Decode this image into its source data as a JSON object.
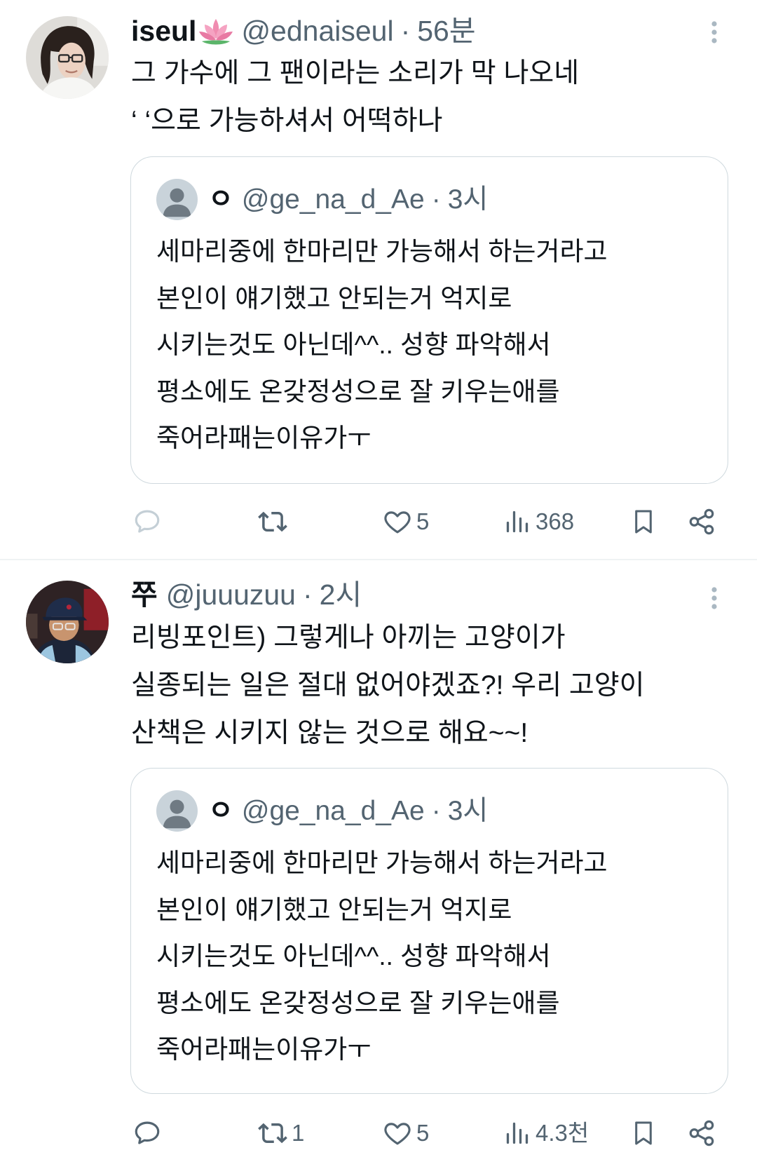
{
  "separator": "·",
  "colors": {
    "primary_text": "#0f1419",
    "secondary_text": "#536471",
    "quote_border": "#cfd9de",
    "divider": "#eff3f4"
  },
  "icons": {
    "more": "more-vertical-icon",
    "reply": "reply-icon",
    "retweet": "retweet-icon",
    "like": "heart-icon",
    "views": "views-chart-icon",
    "bookmark": "bookmark-icon",
    "share": "share-icon"
  },
  "tweets": [
    {
      "author": {
        "display_name": "iseul",
        "name_emoji": "lotus-emoji-icon",
        "handle": "@ednaiseul",
        "time": "56분",
        "avatar": "profile-photo-woman-with-glasses"
      },
      "text_lines": [
        "그 가수에 그 팬이라는 소리가 막 나오네",
        "‘ ‘으로 가능하셔서 어떡하나"
      ],
      "quote": {
        "author": {
          "display_name": "ㅇ",
          "handle": "@ge_na_d_Ae",
          "time": "3시",
          "avatar": "default-profile-icon"
        },
        "text_lines": [
          "세마리중에 한마리만 가능해서 하는거라고",
          "본인이 얘기했고 안되는거 억지로",
          "시키는것도 아닌데^^.. 성향 파악해서",
          "평소에도 온갖정성으로 잘 키우는애를",
          "죽어라패는이유가ㅜ"
        ]
      },
      "actions": {
        "reply": "",
        "retweet": "",
        "like": "5",
        "views": "368"
      }
    },
    {
      "author": {
        "display_name": "쭈",
        "handle": "@juuuzuu",
        "time": "2시",
        "avatar": "profile-photo-man-in-cap"
      },
      "text_lines": [
        "리빙포인트) 그렇게나 아끼는 고양이가",
        "실종되는 일은 절대 없어야겠죠?! 우리 고양이",
        "산책은 시키지 않는 것으로 해요~~!"
      ],
      "quote": {
        "author": {
          "display_name": "ㅇ",
          "handle": "@ge_na_d_Ae",
          "time": "3시",
          "avatar": "default-profile-icon"
        },
        "text_lines": [
          "세마리중에 한마리만 가능해서 하는거라고",
          "본인이 얘기했고 안되는거 억지로",
          "시키는것도 아닌데^^.. 성향 파악해서",
          "평소에도 온갖정성으로 잘 키우는애를",
          "죽어라패는이유가ㅜ"
        ]
      },
      "actions": {
        "reply": "",
        "retweet": "1",
        "like": "5",
        "views": "4.3천"
      }
    }
  ]
}
